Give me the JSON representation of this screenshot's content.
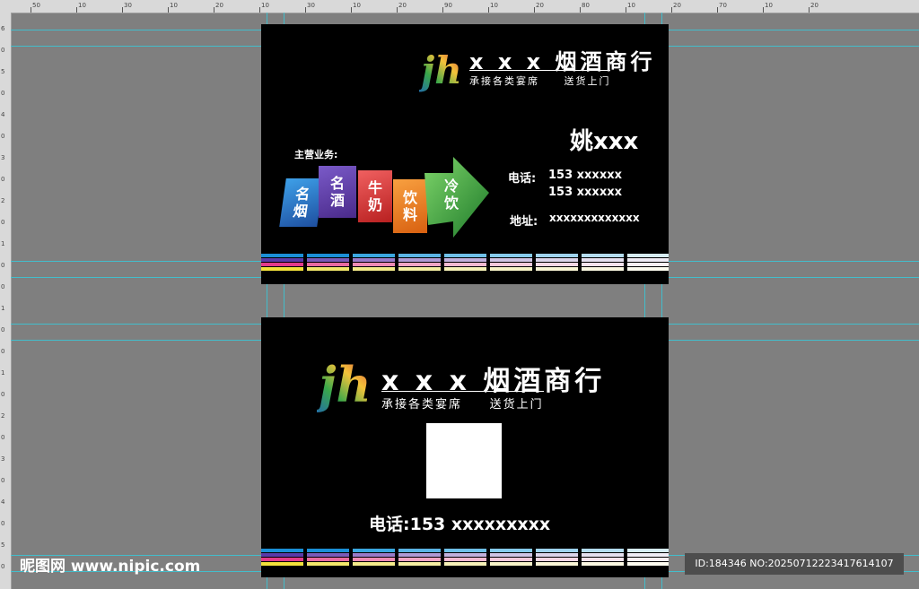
{
  "ruler": {
    "top_ticks": [
      "50",
      "10",
      "30",
      "10",
      "20",
      "10",
      "30",
      "10",
      "20",
      "90",
      "10",
      "20",
      "80",
      "10",
      "20",
      "70",
      "10",
      "20"
    ],
    "left_ticks": [
      "6",
      "0",
      "5",
      "0",
      "4",
      "0",
      "3",
      "0",
      "2",
      "0",
      "1",
      "0",
      "0",
      "1",
      "0",
      "0",
      "1",
      "0",
      "2",
      "0",
      "3",
      "0",
      "4",
      "0",
      "5",
      "0"
    ]
  },
  "front": {
    "shop_name": "x x x 烟酒商行",
    "subtitle": "承接各类宴席     送货上门",
    "person_name": "姚xxx",
    "business_label": "主营业务:",
    "tiles": [
      {
        "text": "名烟",
        "color": "#1e63b8"
      },
      {
        "text": "名酒",
        "color": "#5a3a9a"
      },
      {
        "text": "牛奶",
        "color": "#d83a3a"
      },
      {
        "text": "饮料",
        "color": "#e8781c"
      },
      {
        "text": "冷饮",
        "color": "#3aa84a"
      }
    ],
    "phone_label": "电话:",
    "phone_1": "153 xxxxxx",
    "phone_2": "153 xxxxxx",
    "address_label": "地址:",
    "address": "xxxxxxxxxxxxx"
  },
  "back": {
    "shop_name": "x x x 烟酒商行",
    "subtitle": "承接各类宴席     送货上门",
    "phone": "电话:153 xxxxxxxxx"
  },
  "logo_text": "jh",
  "stripe_colors": [
    "#1a8fd6",
    "#3aa7e0",
    "#6fc0e8",
    "#9fd3ee",
    "#c7e4f2"
  ],
  "stripe_bottom_colors": [
    "#e23a8a",
    "#f3e23a"
  ],
  "watermark": "昵图网 www.nipic.com",
  "id_text": "ID:184346 NO:20250712223417614107"
}
